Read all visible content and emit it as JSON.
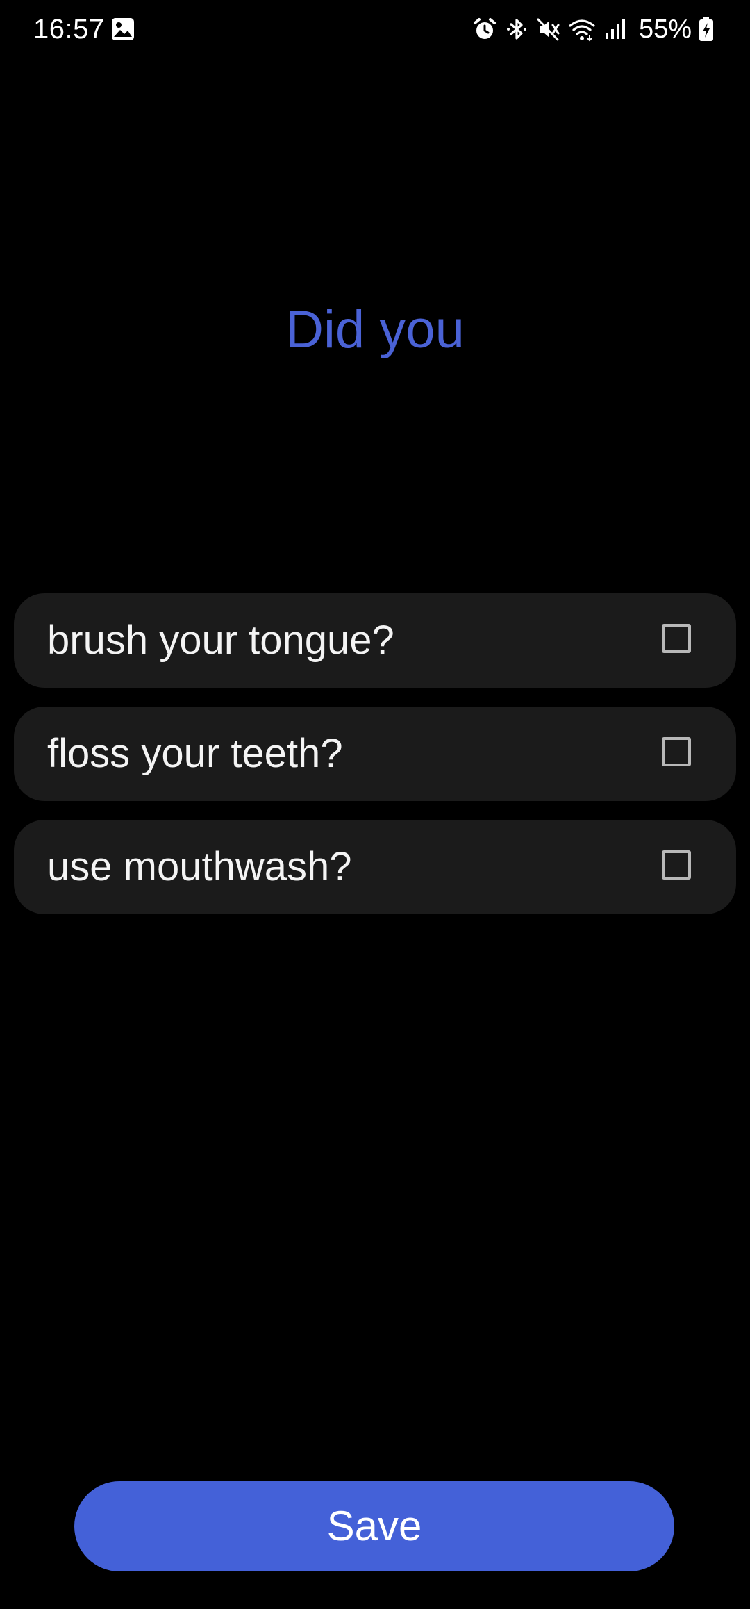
{
  "status_bar": {
    "time": "16:57",
    "battery_percent": "55%",
    "icons": [
      "gallery-icon",
      "alarm-icon",
      "bluetooth-icon",
      "mute-icon",
      "wifi-icon",
      "signal-icon",
      "battery-charging-icon"
    ]
  },
  "heading": "Did you",
  "checklist": {
    "items": [
      {
        "label": "brush your tongue?",
        "checked": false
      },
      {
        "label": "floss your teeth?",
        "checked": false
      },
      {
        "label": "use mouthwash?",
        "checked": false
      }
    ]
  },
  "save_button": {
    "label": "Save"
  },
  "colors": {
    "accent": "#4461d8",
    "heading": "#4a62d6",
    "row_background": "#1b1b1b",
    "background": "#000000"
  }
}
